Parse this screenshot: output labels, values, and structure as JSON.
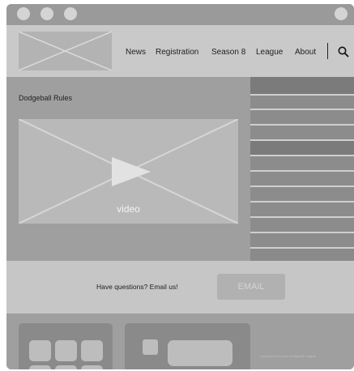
{
  "nav": {
    "items": [
      "News",
      "Registration",
      "Season 8",
      "League",
      "About"
    ]
  },
  "main": {
    "title": "Dodgeball Rules",
    "video_label": "video"
  },
  "contact": {
    "text": "Have questions? Email us!",
    "button_label": "EMAIL"
  },
  "footer": {
    "copyright": "Copyright Richmond Dodgeball League"
  },
  "colors": {
    "frame": "#9a9a9a",
    "header": "#c9c9c9",
    "main": "#9f9f9f",
    "sidebar": "#8a8a8a",
    "contact": "#c6c6c6"
  }
}
